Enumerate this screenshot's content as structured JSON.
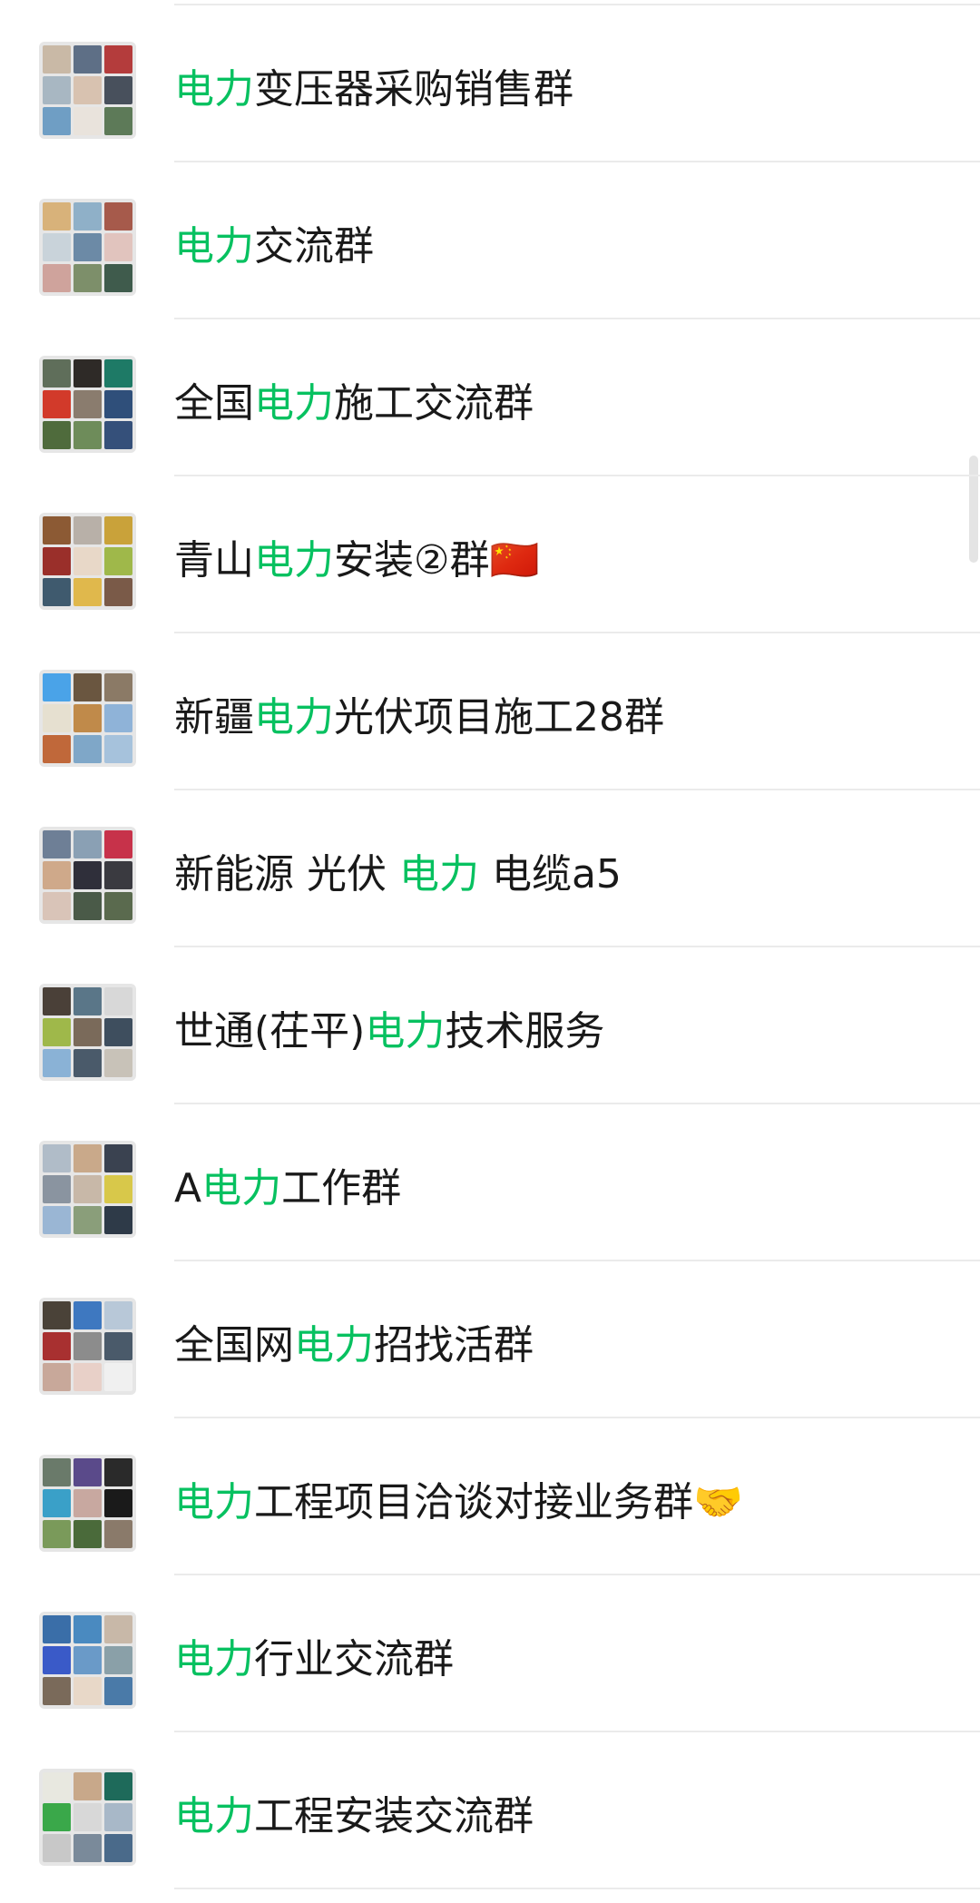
{
  "groups": [
    {
      "pre": "",
      "keyword": "电力",
      "post": "变压器采购销售群",
      "tiles": [
        "#c9b9a6",
        "#5e6f86",
        "#b43c3c",
        "#a8b7c2",
        "#d8c2b0",
        "#48505c",
        "#6f9ec4",
        "#e9e3dc",
        "#5d7a58"
      ]
    },
    {
      "pre": "",
      "keyword": "电力",
      "post": "交流群",
      "tiles": [
        "#d8b27a",
        "#8fb0c8",
        "#a65a4b",
        "#c9d3da",
        "#6c8aa6",
        "#e1c4be",
        "#cfa39c",
        "#7d8f6a",
        "#3f5b4c"
      ]
    },
    {
      "pre": "全国",
      "keyword": "电力",
      "post": "施工交流群",
      "tiles": [
        "#5f6e5a",
        "#2e2a27",
        "#1e7a66",
        "#d23a2a",
        "#8a7c6e",
        "#2f4f7a",
        "#4f6b3c",
        "#6e8c5a",
        "#35507a"
      ]
    },
    {
      "pre": "青山",
      "keyword": "电力",
      "post": "安装②群🇨🇳",
      "tiles": [
        "#8c5a34",
        "#b8b0a8",
        "#c9a23a",
        "#9a2f2a",
        "#e8d8c8",
        "#9fb84a",
        "#3f5a6e",
        "#e0b84c",
        "#7a5a48"
      ]
    },
    {
      "pre": "新疆",
      "keyword": "电力",
      "post": "光伏项目施工28群",
      "tiles": [
        "#4aa3e8",
        "#6a5640",
        "#8b7a66",
        "#e6e0d0",
        "#c08a4a",
        "#8fb3d8",
        "#c0683a",
        "#7fa7c8",
        "#a6c2dc"
      ]
    },
    {
      "pre": "新能源 光伏 ",
      "keyword": "电力",
      "post": " 电缆a5",
      "tiles": [
        "#6e7f96",
        "#8aa0b4",
        "#c7324a",
        "#cfa98a",
        "#2f2f3a",
        "#3a3a40",
        "#d9c4b8",
        "#4a5a48",
        "#5a6a4e"
      ]
    },
    {
      "pre": "世通(茌平)",
      "keyword": "电力",
      "post": "技术服务",
      "tiles": [
        "#4a4038",
        "#5a7688",
        "#d8d8d8",
        "#9fb84a",
        "#7a6a5a",
        "#3e4e5e",
        "#8ab2d6",
        "#4a5a6a",
        "#c8c2b8"
      ]
    },
    {
      "pre": "A",
      "keyword": "电力",
      "post": "工作群",
      "tiles": [
        "#b0bcc8",
        "#c9a98a",
        "#3a4250",
        "#8a94a0",
        "#c8b8a8",
        "#d8c84a",
        "#9ab6d4",
        "#8a9e7a",
        "#2e3a48"
      ]
    },
    {
      "pre": "全国网",
      "keyword": "电力",
      "post": "招找活群",
      "tiles": [
        "#4a4238",
        "#3e78c0",
        "#b8c8d8",
        "#a83030",
        "#8c8c8c",
        "#4a5a6a",
        "#c8a89a",
        "#e8d0c8",
        "#f0f0f0"
      ]
    },
    {
      "pre": "",
      "keyword": "电力",
      "post": "工程项目洽谈对接业务群🤝",
      "tiles": [
        "#6a7a6a",
        "#5a4a8a",
        "#2a2a2a",
        "#3aa0c8",
        "#c8a8a0",
        "#1a1a1a",
        "#7a9a5a",
        "#4a6a3a",
        "#8a7a6a"
      ]
    },
    {
      "pre": "",
      "keyword": "电力",
      "post": "行业交流群",
      "tiles": [
        "#3a6ea8",
        "#4a8ac0",
        "#c8b8a8",
        "#3a5ac8",
        "#6a9ac8",
        "#8aa0a8",
        "#7a6a5a",
        "#e8d8c8",
        "#4a7aa8"
      ]
    },
    {
      "pre": "",
      "keyword": "电力",
      "post": "工程安装交流群",
      "tiles": [
        "#e8e8e0",
        "#c8a88a",
        "#1e6a5a",
        "#3aa84a",
        "#d8d8d8",
        "#a8b8c8",
        "#c8c8c8",
        "#7a8a9a",
        "#4a6a8a"
      ]
    }
  ]
}
